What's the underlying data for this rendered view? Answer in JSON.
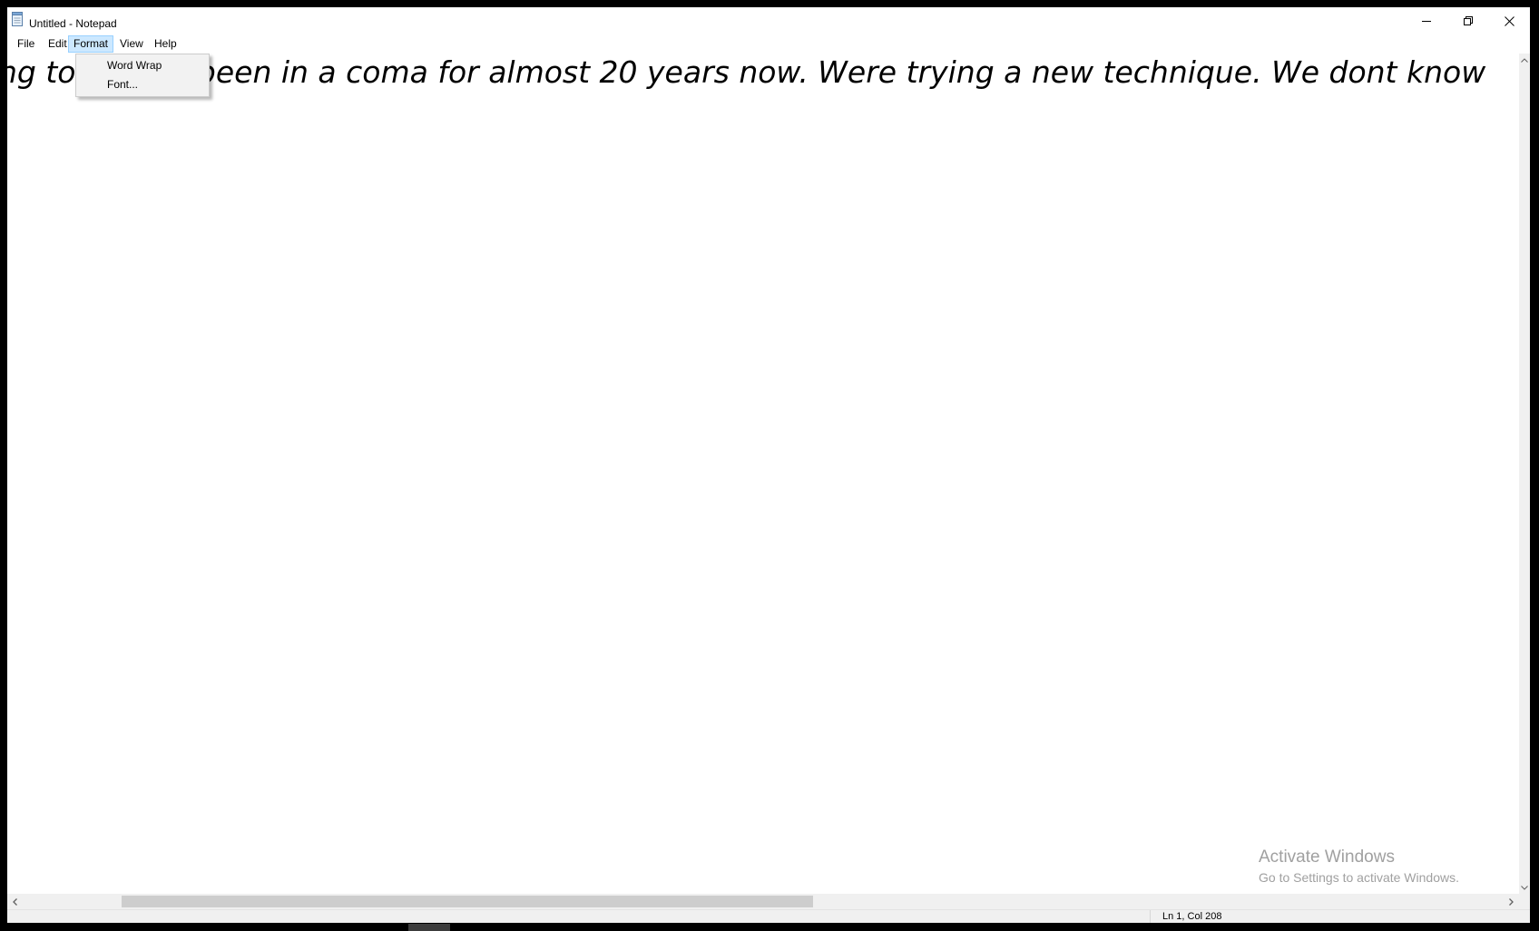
{
  "window": {
    "title": "Untitled - Notepad",
    "app_icon": "notepad-icon",
    "controls": [
      "minimize-icon",
      "restore-icon",
      "close-icon"
    ]
  },
  "menubar": {
    "items": [
      "File",
      "Edit",
      "Format",
      "View",
      "Help"
    ],
    "active": "Format"
  },
  "format_menu": {
    "items": [
      "Word Wrap",
      "Font..."
    ]
  },
  "editor": {
    "visible_text": "ng to... have been in a coma for almost 20 years now. Were trying a new technique. We dont know"
  },
  "scrollbars": {
    "horizontal": {
      "left_icon": "chevron-left-icon",
      "right_icon": "chevron-right-icon"
    },
    "vertical": {
      "up_icon": "chevron-up-icon",
      "down_icon": "chevron-down-icon"
    }
  },
  "statusbar": {
    "position": "Ln 1, Col 208"
  },
  "watermark": {
    "title": "Activate Windows",
    "subtitle": "Go to Settings to activate Windows."
  }
}
